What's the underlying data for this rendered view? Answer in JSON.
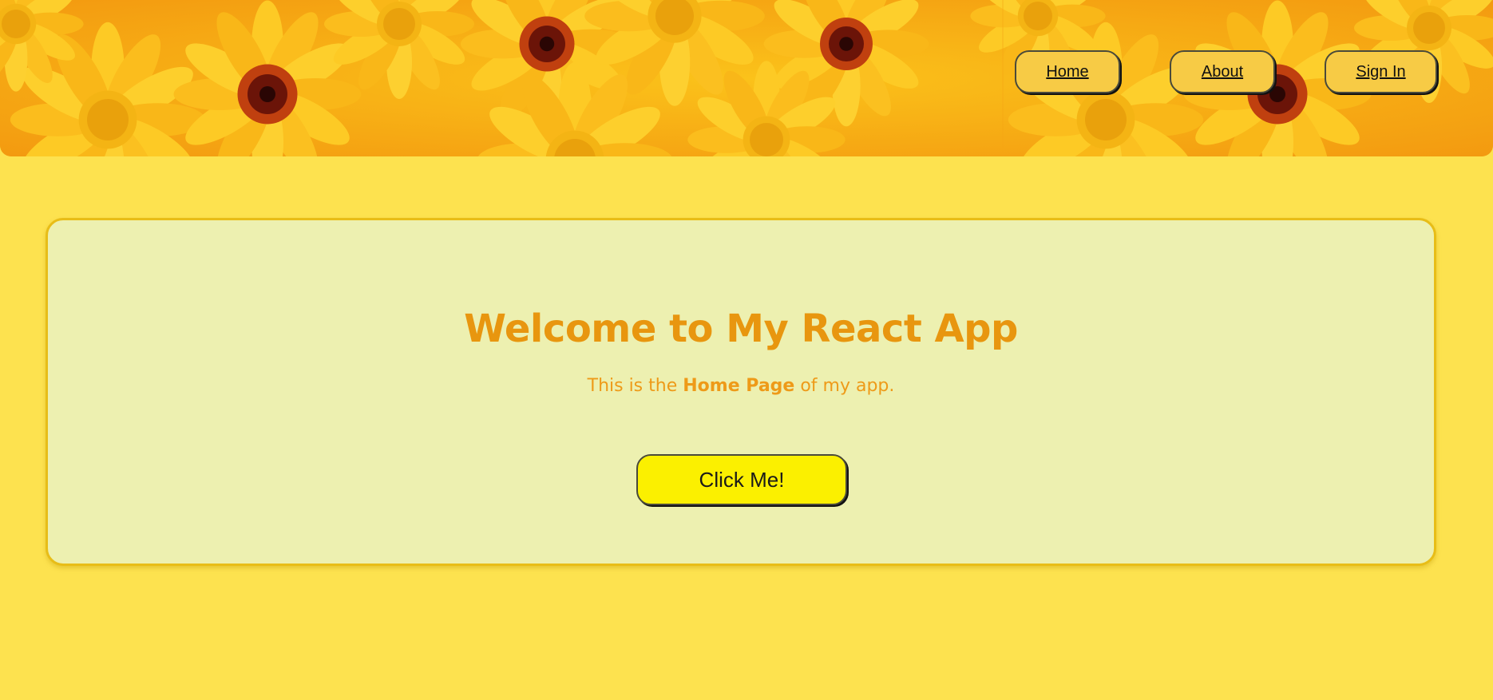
{
  "header": {
    "background": "yellow-flowers-image"
  },
  "nav": {
    "items": [
      {
        "label": "Home"
      },
      {
        "label": "About"
      },
      {
        "label": "Sign In"
      }
    ]
  },
  "main": {
    "title": "Welcome to My React App",
    "subtitle_prefix": "This is the",
    "subtitle_bold": "Home Page",
    "subtitle_suffix": "of my app.",
    "button_label": "Click Me!"
  },
  "colors": {
    "page_background": "#fde24f",
    "card_background": "#edf0b0",
    "card_border": "#e8bd17",
    "heading": "#e8960f",
    "nav_button": "#f7cb45",
    "cta_button": "#fbf000"
  }
}
